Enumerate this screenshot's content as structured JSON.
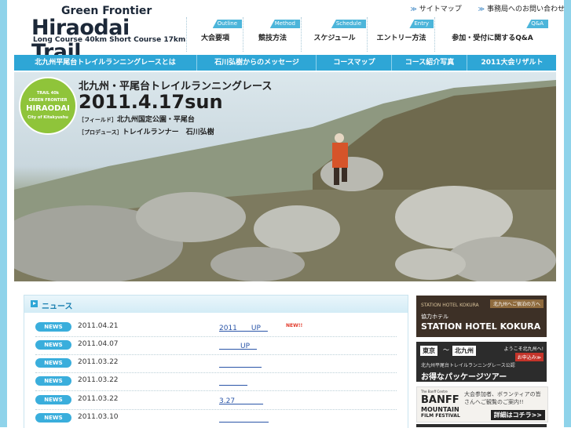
{
  "logo": {
    "line1": "Green Frontier",
    "line2": "Hiraodai Trail",
    "line3": "Long Course 40km  Short Course 17km"
  },
  "top_links": {
    "sitemap": "サイトマップ",
    "contact": "事務局へのお問い合わせ"
  },
  "nav": [
    {
      "tag": "Outline",
      "label": "大会要項"
    },
    {
      "tag": "Method",
      "label": "競技方法"
    },
    {
      "tag": "Schedule",
      "label": "スケジュール"
    },
    {
      "tag": "Entry",
      "label": "エントリー方法"
    },
    {
      "tag": "Q&A",
      "label": "参加・受付に関するQ&A"
    }
  ],
  "subnav": [
    "北九州平尾台トレイルランニングレースとは",
    "石川弘樹からのメッセージ",
    "コースマップ",
    "コース紹介写真",
    "2011大会リザルト"
  ],
  "hero": {
    "badge_top": "TRAIL 40k",
    "badge_mid": "GREEN FRONTIER",
    "badge_main": "HIRAODAI",
    "badge_sub": "City of Kitakyushu",
    "title": "北九州・平尾台トレイルランニングレース",
    "date": "2011.4.17sun",
    "field_label": "［フィールド］",
    "field": "北九州国定公園・平尾台",
    "produce_label": "［プロデュース］",
    "produce": "トレイルランナー　石川弘樹"
  },
  "news": {
    "heading": "ニュース",
    "badge_label": "NEWS",
    "items": [
      {
        "date": "2011.04.21",
        "link": "2011　　UP　",
        "new": "NEW!!"
      },
      {
        "date": "2011.04.07",
        "link": "　　　UP　",
        "new": ""
      },
      {
        "date": "2011.03.22",
        "link": "　　　　　　",
        "new": ""
      },
      {
        "date": "2011.03.22",
        "link": "　　　　",
        "new": ""
      },
      {
        "date": "2011.03.22",
        "link": "3.27　　　　",
        "new": ""
      },
      {
        "date": "2011.03.10",
        "link": "　　　　　　　",
        "new": ""
      }
    ]
  },
  "banners": {
    "hotel_top": "STATION HOTEL KOKURA",
    "hotel_tag": "北九州へご宿泊の方へ",
    "hotel_small": "協力ホテル",
    "hotel_name": "STATION HOTEL KOKURA",
    "tour_from": "東京",
    "tour_sep": "〜",
    "tour_to": "北九州",
    "tour_welcome": "ようこそ北九州へ!",
    "tour_apply": "お申込み≫",
    "tour_line1": "北九州平尾台トレイルランニングレース公認",
    "tour_line2": "お得なパッケージツアー",
    "banff_brand": "The Banff Centre",
    "banff_l1": "BANFF",
    "banff_l2": "MOUNTAIN",
    "banff_l3": "FILM FESTIVAL",
    "banff_desc": "大会参加者、ボランティアの皆さんへご観覧のご案内!!",
    "banff_more": "詳細はコチラ>>"
  },
  "colors": {
    "frame": "#8fd3ea",
    "accent": "#2ea6d6",
    "badge_green": "#8fc43a",
    "new_red": "#e23a2a"
  }
}
